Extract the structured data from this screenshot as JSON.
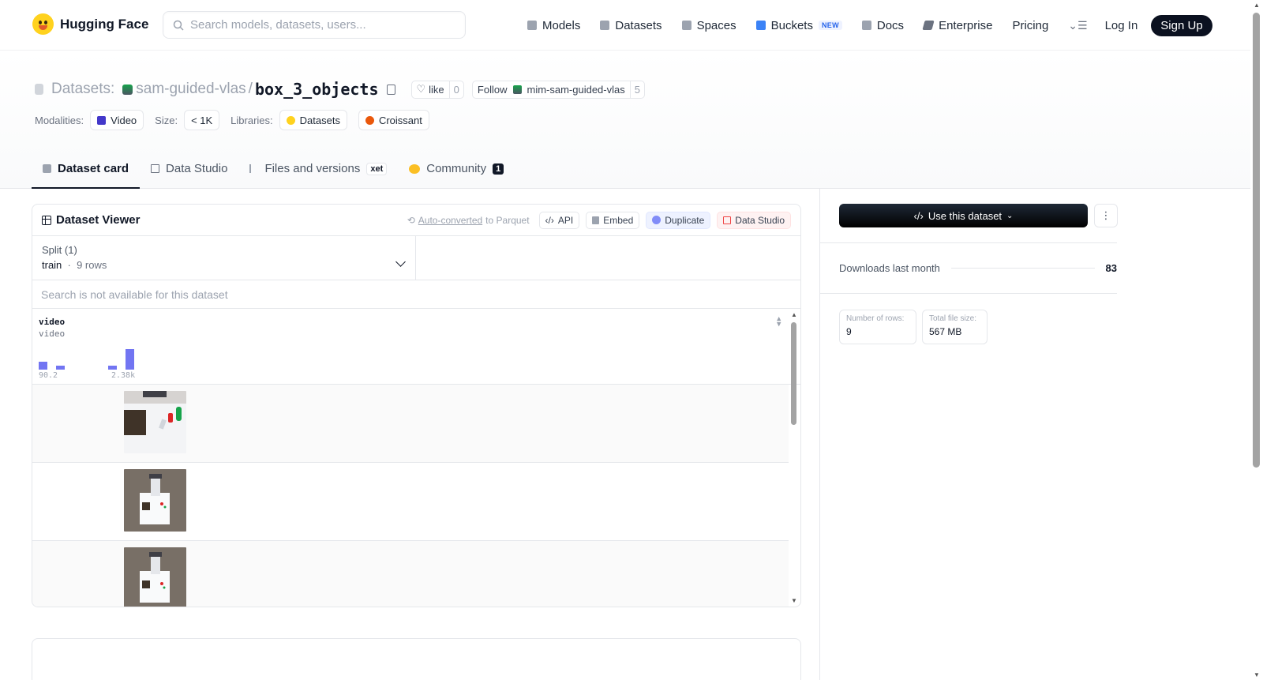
{
  "nav": {
    "brand": "Hugging Face",
    "search_placeholder": "Search models, datasets, users...",
    "links": [
      {
        "label": "Models",
        "icon": "cube-icon",
        "color": "#9ca3af"
      },
      {
        "label": "Datasets",
        "icon": "database-icon",
        "color": "#9ca3af"
      },
      {
        "label": "Spaces",
        "icon": "grid-icon",
        "color": "#9ca3af"
      },
      {
        "label": "Buckets",
        "icon": "bucket-icon",
        "color": "#3b82f6",
        "badge": "NEW"
      },
      {
        "label": "Docs",
        "icon": "book-icon",
        "color": "#9ca3af"
      },
      {
        "label": "Enterprise",
        "icon": "enterprise-icon",
        "color": "#6b7280"
      },
      {
        "label": "Pricing"
      }
    ],
    "login": "Log In",
    "signup": "Sign Up"
  },
  "repo": {
    "type_label": "Datasets:",
    "owner": "sam-guided-vlas",
    "slash": "/",
    "name": "box_3_objects",
    "like_label": "like",
    "like_count": "0",
    "follow_label": "Follow",
    "follow_org": "mim-sam-guided-vlas",
    "follow_count": "5"
  },
  "tags": {
    "modalities_label": "Modalities:",
    "modality": "Video",
    "size_label": "Size:",
    "size": "< 1K",
    "libraries_label": "Libraries:",
    "libraries": [
      "Datasets",
      "Croissant"
    ]
  },
  "tabs": [
    {
      "label": "Dataset card"
    },
    {
      "label": "Data Studio"
    },
    {
      "label": "Files and versions",
      "badge": "xet"
    },
    {
      "label": "Community",
      "count": "1"
    }
  ],
  "viewer": {
    "title": "Dataset Viewer",
    "auto_converted_link": "Auto-converted",
    "auto_converted_rest": "to Parquet",
    "api": "API",
    "embed": "Embed",
    "duplicate": "Duplicate",
    "data_studio": "Data Studio",
    "split_label": "Split (1)",
    "split_value": "train",
    "split_rows": "9 rows",
    "search_disabled": "Search is not available for this dataset",
    "column_name": "video",
    "column_type": "video",
    "hist_min": "90.2",
    "hist_max": "2.38k",
    "hist_heights": [
      0.38,
      0.2,
      0,
      0,
      0.2,
      1
    ]
  },
  "sidebar": {
    "use_button": "Use this dataset",
    "downloads_label": "Downloads last month",
    "downloads_value": "83",
    "rows_label": "Number of rows:",
    "rows_value": "9",
    "size_label": "Total file size:",
    "size_value": "567 MB"
  }
}
